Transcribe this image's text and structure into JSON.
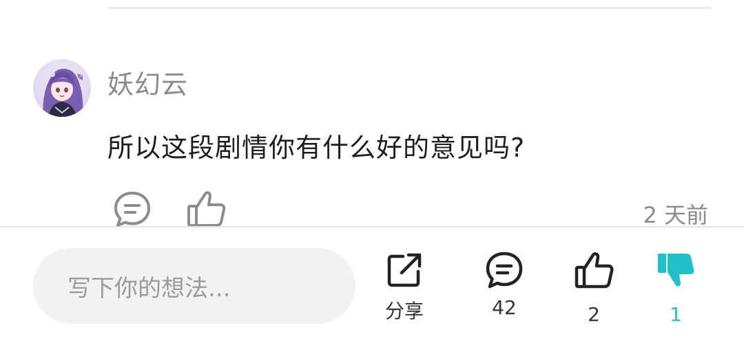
{
  "comment": {
    "username": "妖幻云",
    "text": "所以这段剧情你有什么好的意见吗?",
    "time_ago": "2 天前"
  },
  "bottom_bar": {
    "input_placeholder": "写下你的想法...",
    "share_label": "分享",
    "comment_count": "42",
    "like_count": "2",
    "dislike_count": "1"
  },
  "icons": {
    "reply": "chat-bubble-icon",
    "like": "thumbs-up-icon",
    "share": "share-icon",
    "comments": "chat-bubble-icon",
    "dislike": "thumbs-down-icon"
  },
  "colors": {
    "accent_teal": "#20bfc9",
    "muted_text": "#8a8a8a",
    "input_bg": "#f2f2f2"
  }
}
